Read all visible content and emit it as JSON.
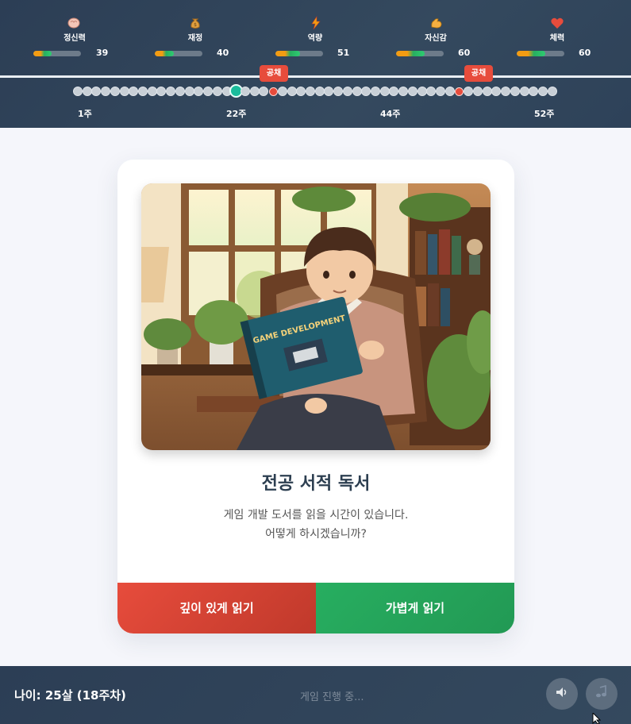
{
  "stats": [
    {
      "name": "정신력",
      "value": "39",
      "fill": 0.39,
      "icon": "brain-icon"
    },
    {
      "name": "재정",
      "value": "40",
      "fill": 0.4,
      "icon": "money-bag-icon"
    },
    {
      "name": "역량",
      "value": "51",
      "fill": 0.51,
      "icon": "lightning-icon"
    },
    {
      "name": "자신감",
      "value": "60",
      "fill": 0.6,
      "icon": "flexed-bicep-icon"
    },
    {
      "name": "체력",
      "value": "60",
      "fill": 0.6,
      "icon": "heart-icon"
    }
  ],
  "timeline": {
    "total_weeks": 52,
    "current_week": 18,
    "event_weeks": [
      22,
      42
    ],
    "event_label": "공채",
    "week_labels": [
      "1주",
      "22주",
      "44주",
      "52주"
    ]
  },
  "event": {
    "image": "man-reading-game-development-book-illustration",
    "book_title": "GAME DEVELOPMENT",
    "title": "전공 서적 독서",
    "description_line1": "게임 개발 도서를 읽을 시간이 있습니다.",
    "description_line2": "어떻게 하시겠습니까?",
    "choice_left": "깊이 있게 읽기",
    "choice_right": "가볍게 읽기"
  },
  "footer": {
    "age": "나이: 25살 (18주차)",
    "status": "게임 진행 중...",
    "sound_icon": "speaker-icon",
    "music_icon": "music-note-icon"
  },
  "colors": {
    "header_bg": "#2c3e55",
    "choice_left": "#e74c3c",
    "choice_right": "#27ae60",
    "event_marker": "#e74c3c",
    "current_marker": "#1abc9c"
  }
}
